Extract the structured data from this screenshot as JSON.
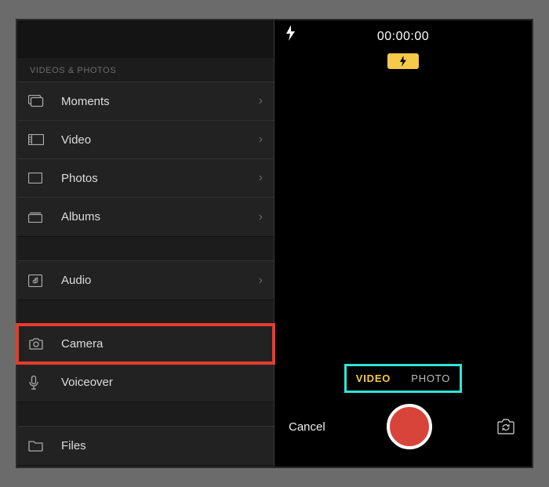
{
  "sidebar": {
    "section_header": "VIDEOS & PHOTOS",
    "group1": [
      {
        "label": "Moments",
        "icon": "moments-icon"
      },
      {
        "label": "Video",
        "icon": "video-icon"
      },
      {
        "label": "Photos",
        "icon": "photos-icon"
      },
      {
        "label": "Albums",
        "icon": "albums-icon"
      }
    ],
    "group2": [
      {
        "label": "Audio",
        "icon": "audio-icon"
      }
    ],
    "group3": [
      {
        "label": "Camera",
        "icon": "camera-icon",
        "highlighted": true
      },
      {
        "label": "Voiceover",
        "icon": "mic-icon"
      }
    ],
    "group4": [
      {
        "label": "Files",
        "icon": "folder-icon"
      }
    ]
  },
  "camera": {
    "timer": "00:00:00",
    "modes": {
      "video": "VIDEO",
      "photo": "PHOTO",
      "active": "video"
    },
    "cancel": "Cancel"
  }
}
